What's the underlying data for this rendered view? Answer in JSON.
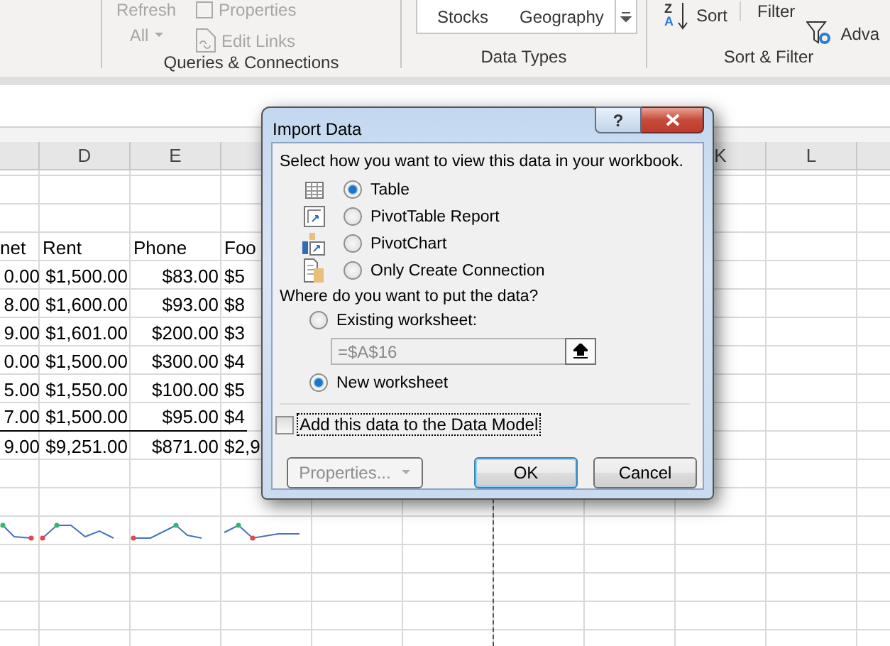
{
  "ribbon": {
    "queries_group": {
      "label": "Queries & Connections",
      "refresh": {
        "label": "Refresh",
        "sublabel": "All",
        "disabled": true
      },
      "commands": [
        {
          "label": "Properties",
          "kind": "properties",
          "disabled": true
        },
        {
          "label": "Edit Links",
          "kind": "links",
          "disabled": true
        }
      ]
    },
    "data_types_group": {
      "label": "Data Types",
      "types": [
        "Stocks",
        "Geography"
      ]
    },
    "sort_filter_group": {
      "label": "Sort & Filter",
      "commands": [
        {
          "label": "Sort",
          "kind": "sort",
          "icon_text": [
            "Z",
            "A"
          ]
        },
        {
          "label": "Filter",
          "kind": "filter"
        },
        {
          "label": "Adva",
          "kind": "advanced"
        }
      ]
    }
  },
  "sheet": {
    "left_columns": [
      "D",
      "E"
    ],
    "right_columns": [
      "K",
      "L"
    ],
    "rows": [
      {
        "kind": "heading",
        "cells": [
          "net",
          "Rent",
          "Phone",
          "Foo"
        ]
      },
      {
        "kind": "data",
        "cells": [
          "0.00",
          "$1,500.00",
          "$83.00",
          "$5"
        ]
      },
      {
        "kind": "data",
        "cells": [
          "8.00",
          "$1,600.00",
          "$93.00",
          "$8"
        ]
      },
      {
        "kind": "data",
        "cells": [
          "9.00",
          "$1,601.00",
          "$200.00",
          "$3"
        ]
      },
      {
        "kind": "data",
        "cells": [
          "0.00",
          "$1,500.00",
          "$300.00",
          "$4"
        ]
      },
      {
        "kind": "data",
        "cells": [
          "5.00",
          "$1,550.00",
          "$100.00",
          "$5"
        ]
      },
      {
        "kind": "data",
        "cells": [
          "7.00",
          "$1,500.00",
          "$95.00",
          "$4"
        ]
      },
      {
        "kind": "total",
        "cells": [
          "9.00",
          "$9,251.00",
          "$871.00",
          "$2,9"
        ]
      }
    ]
  },
  "dialog": {
    "title": "Import Data",
    "help_button": "?",
    "prompt": "Select how you want to view this data in your workbook.",
    "view_options": [
      {
        "label": "Table",
        "kind": "table",
        "selected": true
      },
      {
        "label": "PivotTable Report",
        "kind": "pivot_table",
        "selected": false
      },
      {
        "label": "PivotChart",
        "kind": "pivot_chart",
        "selected": false
      },
      {
        "label": "Only Create Connection",
        "kind": "connection",
        "selected": false
      }
    ],
    "location_prompt": "Where do you want to put the data?",
    "location_options": [
      {
        "label": "Existing worksheet:",
        "selected": false,
        "reference": {
          "value": "=$A$16",
          "disabled": true
        }
      },
      {
        "label": "New worksheet",
        "selected": true
      }
    ],
    "data_model": {
      "label": "Add this data to the Data Model",
      "checked": false
    },
    "buttons": [
      {
        "label": "Properties...",
        "kind": "dropdown",
        "disabled": true
      },
      {
        "label": "OK",
        "kind": "default",
        "disabled": false
      },
      {
        "label": "Cancel",
        "kind": "normal",
        "disabled": false
      }
    ]
  }
}
